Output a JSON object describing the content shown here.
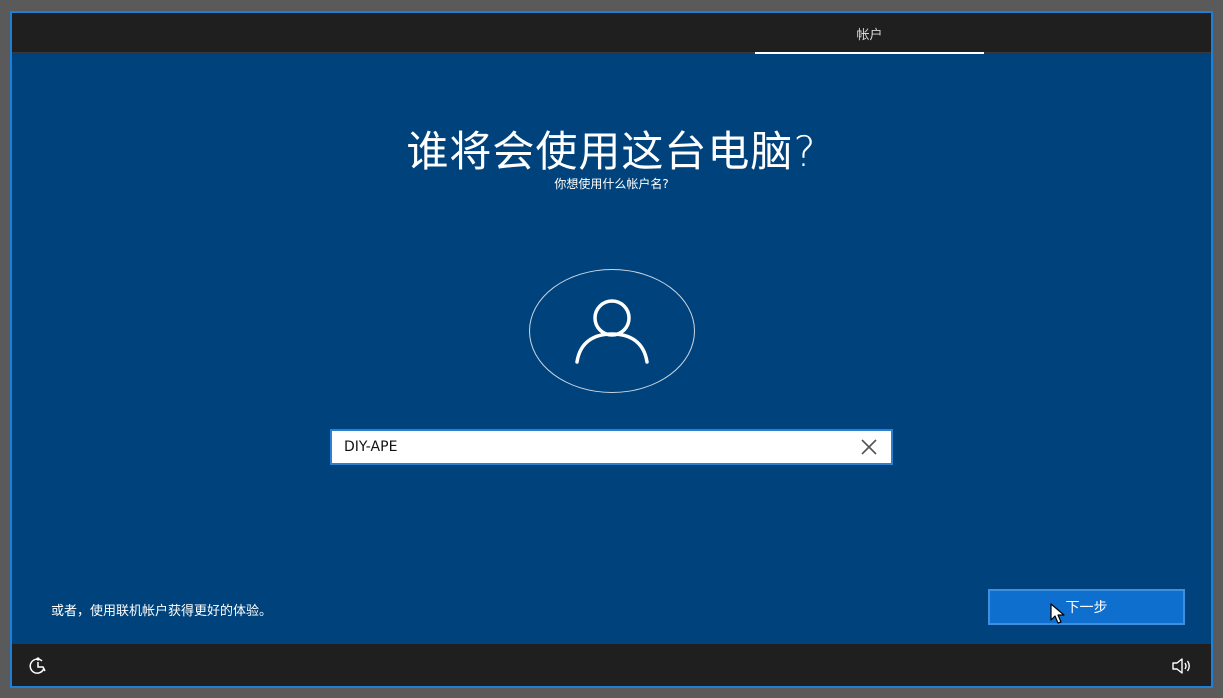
{
  "header": {
    "current_step": "帐户"
  },
  "main": {
    "title": "谁将会使用这台电脑?",
    "subtitle": "你想使用什么帐户名?"
  },
  "account": {
    "name_value": "DIY-APE"
  },
  "footer": {
    "online_account_link": "或者，使用联机帐户获得更好的体验。",
    "next_button": "下一步"
  },
  "icons": {
    "avatar": "person-icon",
    "clear": "close-icon",
    "ease_of_access": "ease-of-access-icon",
    "volume": "volume-icon",
    "cursor": "mouse-pointer-icon"
  },
  "colors": {
    "background": "#00437c",
    "bars": "#1f1f1f",
    "accent": "#0f6fcf",
    "window_border": "#1e7fd8"
  }
}
